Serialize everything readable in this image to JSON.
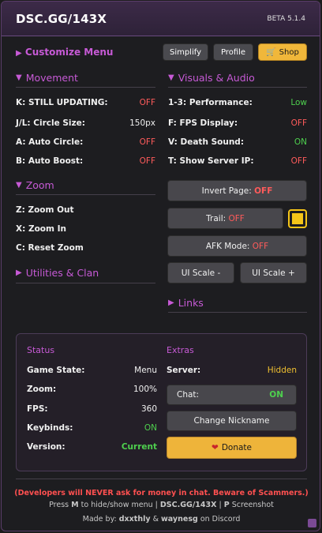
{
  "header": {
    "title": "DSC.GG/143X",
    "version": "BETA 5.1.4"
  },
  "toolbar": {
    "customize": "Customize Menu",
    "simplify": "Simplify",
    "profile": "Profile",
    "shop": "Shop",
    "shop_icon": "shop-icon"
  },
  "movement": {
    "title": "Movement",
    "rows": [
      {
        "label": "K: STILL UPDATING:",
        "value": "OFF"
      },
      {
        "label": "J/L: Circle Size:",
        "value": "150px"
      },
      {
        "label": "A: Auto Circle:",
        "value": "OFF"
      },
      {
        "label": "B: Auto Boost:",
        "value": "OFF"
      }
    ]
  },
  "visuals": {
    "title": "Visuals & Audio",
    "rows": [
      {
        "label": "1-3: Performance:",
        "value": "Low"
      },
      {
        "label": "F: FPS Display:",
        "value": "OFF"
      },
      {
        "label": "V: Death Sound:",
        "value": "ON"
      },
      {
        "label": "T: Show Server IP:",
        "value": "OFF"
      }
    ]
  },
  "zoom": {
    "title": "Zoom",
    "rows": [
      "Z: Zoom Out",
      "X: Zoom In",
      "C: Reset Zoom"
    ]
  },
  "utilities": {
    "title": "Utilities & Clan"
  },
  "links": {
    "title": "Links"
  },
  "controls": {
    "invert_label": "Invert Page:",
    "invert_value": "OFF",
    "trail_label": "Trail:",
    "trail_value": "OFF",
    "trail_color": "#f5c518",
    "afk_label": "AFK Mode:",
    "afk_value": "OFF",
    "ui_minus": "UI Scale -",
    "ui_plus": "UI Scale +"
  },
  "status": {
    "title": "Status",
    "rows": [
      {
        "label": "Game State:",
        "value": "Menu"
      },
      {
        "label": "Zoom:",
        "value": "100%"
      },
      {
        "label": "FPS:",
        "value": "360"
      },
      {
        "label": "Keybinds:",
        "value": "ON"
      },
      {
        "label": "Version:",
        "value": "Current"
      }
    ]
  },
  "extras": {
    "title": "Extras",
    "server_label": "Server:",
    "server_value": "Hidden",
    "chat_label": "Chat:",
    "chat_value": "ON",
    "nickname": "Change Nickname",
    "donate": "Donate"
  },
  "footer": {
    "warning": "(Developers will NEVER ask for money in chat. Beware of Scammers.)",
    "hint_press": "Press",
    "hint_key": "M",
    "hint_mid": "to hide/show menu |",
    "hint_site": "DSC.GG/143X",
    "hint_sep": "|",
    "hint_p": "P",
    "hint_end": "Screenshot",
    "made_by": "Made by:",
    "author1": "dxxthly",
    "amp": "&",
    "author2": "waynesg",
    "on_discord": "on Discord"
  },
  "colors": {
    "accent": "#c75ad6",
    "off": "#ff5b5b",
    "on": "#4ed04e",
    "highlight": "#f0c030",
    "shop": "#f0b73a"
  }
}
